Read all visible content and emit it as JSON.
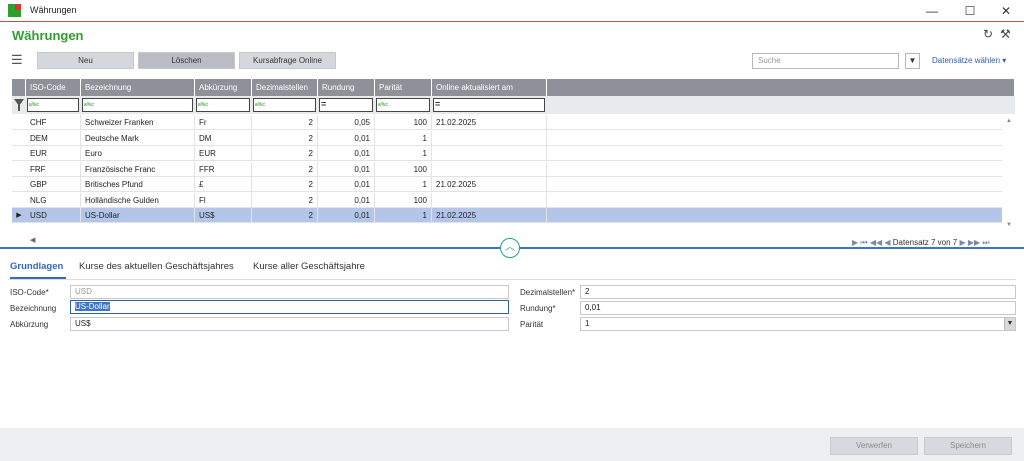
{
  "window": {
    "title": "Währungen",
    "minimize": "—",
    "maximize": "☐",
    "close": "✕"
  },
  "page": {
    "title": "Währungen",
    "refresh_icon": "↻",
    "settings_icon": "⚒"
  },
  "toolbar": {
    "menu_icon": "☰",
    "new_label": "Neu",
    "delete_label": "Löschen",
    "rate_query_label": "Kursabfrage Online",
    "search_placeholder": "Suche",
    "search_dropdown": "▼",
    "records_select_label": "Datensätze wählen ▾"
  },
  "grid": {
    "columns": [
      "ISO-Code",
      "Bezeichnung",
      "Abkürzung",
      "Dezimalstellen",
      "Rundung",
      "Parität",
      "Online aktualisiert am"
    ],
    "filter_ops": [
      "a%c",
      "a%c",
      "a%c",
      "a%c",
      "=",
      "a%c",
      "="
    ],
    "rows": [
      [
        "CHF",
        "Schweizer Franken",
        "Fr",
        "2",
        "0,05",
        "100",
        "21.02.2025"
      ],
      [
        "DEM",
        "Deutsche Mark",
        "DM",
        "2",
        "0,01",
        "1",
        ""
      ],
      [
        "EUR",
        "Euro",
        "EUR",
        "2",
        "0,01",
        "1",
        ""
      ],
      [
        "FRF",
        "Französische Franc",
        "FFR",
        "2",
        "0,01",
        "100",
        ""
      ],
      [
        "GBP",
        "Britisches Pfund",
        "£",
        "2",
        "0,01",
        "1",
        "21.02.2025"
      ],
      [
        "NLG",
        "Holländische Gulden",
        "Fl",
        "2",
        "0,01",
        "100",
        ""
      ],
      [
        "USD",
        "US-Dollar",
        "US$",
        "2",
        "0,01",
        "1",
        "21.02.2025"
      ]
    ],
    "selected_index": 6,
    "row_indicator": "▶",
    "pager_first": "⏮",
    "pager_prev_page": "◀◀",
    "pager_prev": "◀",
    "pager_status": "Datensatz 7 von 7",
    "pager_next": "▶",
    "pager_next_page": "▶▶",
    "pager_last": "⏭",
    "collapse_icon": "︿",
    "scroll_up": "▲",
    "scroll_down": "▼",
    "scroll_left": "◀"
  },
  "tabs": [
    {
      "label": "Grundlagen",
      "active": true
    },
    {
      "label": "Kurse des aktuellen Geschäftsjahres",
      "active": false
    },
    {
      "label": "Kurse aller Geschäftsjahre",
      "active": false
    }
  ],
  "form": {
    "iso_label": "ISO-Code*",
    "iso_value": "USD",
    "bezeichnung_label": "Bezeichnung",
    "bezeichnung_value": "US-Dollar",
    "abkuerzung_label": "Abkürzung",
    "abkuerzung_value": "US$",
    "dezimal_label": "Dezimalstellen*",
    "dezimal_value": "2",
    "rundung_label": "Rundung*",
    "rundung_value": "0,01",
    "paritaet_label": "Parität",
    "paritaet_value": "1",
    "dropdown_icon": "▼"
  },
  "footer": {
    "discard_label": "Verwerfen",
    "save_label": "Speichern"
  },
  "colors": {
    "accent_green": "#2e9e2e",
    "header_gray": "#8e9197",
    "selection_blue": "#b3c6ea",
    "link_blue": "#2f5ea8"
  }
}
